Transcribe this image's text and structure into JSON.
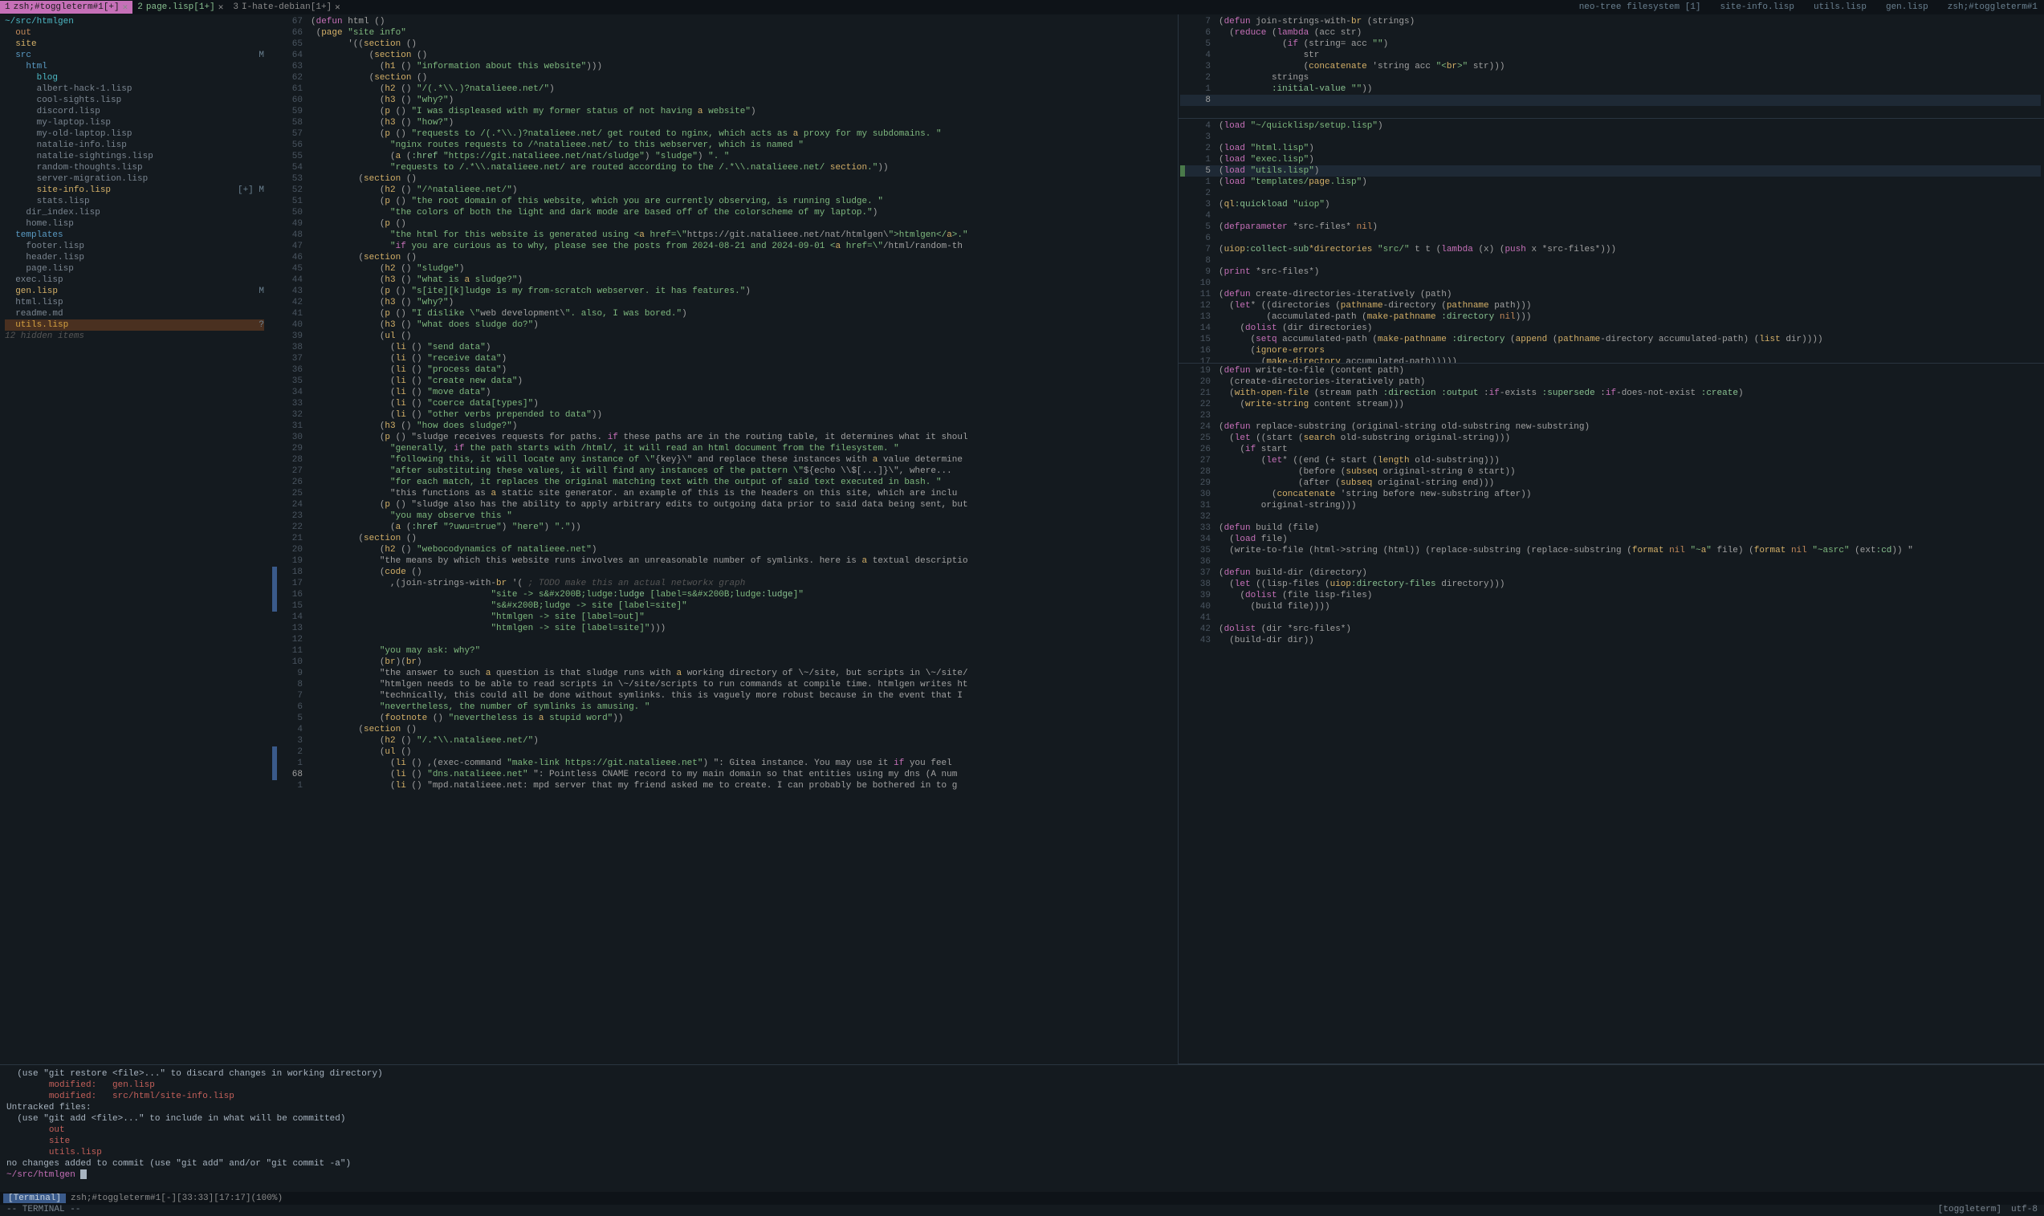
{
  "tabbar": {
    "tabs": [
      {
        "num": "1",
        "label": "zsh;#toggleterm#1[+]",
        "active": true,
        "closable": true
      },
      {
        "num": "2",
        "label": "page.lisp[1+]",
        "active": false,
        "green": true,
        "closable": true
      },
      {
        "num": "3",
        "label": "I-hate-debian[1+]",
        "active": false,
        "closable": true
      }
    ],
    "winbars": [
      "neo-tree filesystem [1]",
      "site-info.lisp",
      "utils.lisp",
      "gen.lisp",
      "zsh;#toggleterm#1"
    ]
  },
  "tree": {
    "root": "~/src/htmlgen",
    "items": [
      {
        "indent": 1,
        "name": "out",
        "cls": "t-orange"
      },
      {
        "indent": 1,
        "name": "site",
        "cls": "t-yellow"
      },
      {
        "indent": 1,
        "name": "src",
        "cls": "t-blue",
        "mark": "M"
      },
      {
        "indent": 2,
        "name": "html",
        "cls": "t-blue"
      },
      {
        "indent": 3,
        "name": "blog",
        "cls": "t-cyan"
      },
      {
        "indent": 3,
        "name": "albert-hack-1.lisp",
        "cls": "t-grey"
      },
      {
        "indent": 3,
        "name": "cool-sights.lisp",
        "cls": "t-grey"
      },
      {
        "indent": 3,
        "name": "discord.lisp",
        "cls": "t-grey"
      },
      {
        "indent": 3,
        "name": "my-laptop.lisp",
        "cls": "t-grey"
      },
      {
        "indent": 3,
        "name": "my-old-laptop.lisp",
        "cls": "t-grey"
      },
      {
        "indent": 3,
        "name": "natalie-info.lisp",
        "cls": "t-grey"
      },
      {
        "indent": 3,
        "name": "natalie-sightings.lisp",
        "cls": "t-grey"
      },
      {
        "indent": 3,
        "name": "random-thoughts.lisp",
        "cls": "t-grey"
      },
      {
        "indent": 3,
        "name": "server-migration.lisp",
        "cls": "t-grey"
      },
      {
        "indent": 3,
        "name": "site-info.lisp",
        "cls": "t-mod",
        "mark": "[+] M"
      },
      {
        "indent": 3,
        "name": "stats.lisp",
        "cls": "t-grey"
      },
      {
        "indent": 2,
        "name": "dir_index.lisp",
        "cls": "t-grey"
      },
      {
        "indent": 2,
        "name": "home.lisp",
        "cls": "t-grey"
      },
      {
        "indent": 1,
        "name": "templates",
        "cls": "t-blue"
      },
      {
        "indent": 2,
        "name": "footer.lisp",
        "cls": "t-grey"
      },
      {
        "indent": 2,
        "name": "header.lisp",
        "cls": "t-grey"
      },
      {
        "indent": 2,
        "name": "page.lisp",
        "cls": "t-grey"
      },
      {
        "indent": 1,
        "name": "exec.lisp",
        "cls": "t-grey"
      },
      {
        "indent": 1,
        "name": "gen.lisp",
        "cls": "t-mod",
        "mark": "M"
      },
      {
        "indent": 1,
        "name": "html.lisp",
        "cls": "t-grey"
      },
      {
        "indent": 1,
        "name": "readme.md",
        "cls": "t-grey"
      },
      {
        "indent": 1,
        "name": "utils.lisp",
        "cls": "blink-orange",
        "mark": "?"
      }
    ],
    "hidden": "12 hidden items"
  },
  "leftcode": {
    "cursor_line": 60,
    "lines": [
      {
        "n": 67,
        "t": "(defun html ()"
      },
      {
        "n": 66,
        "t": " (page \"site info\""
      },
      {
        "n": 65,
        "t": "       '((section ()"
      },
      {
        "n": 64,
        "t": "           (section ()"
      },
      {
        "n": 63,
        "t": "             (h1 () \"information about this website\")))"
      },
      {
        "n": 62,
        "t": "           (section ()"
      },
      {
        "n": 61,
        "t": "             (h2 () \"/(.*\\\\.)?natalieee.net/\")"
      },
      {
        "n": 60,
        "t": "             (h3 () \"why?\")"
      },
      {
        "n": 59,
        "t": "             (p () \"I was displeased with my former status of not having a website\")"
      },
      {
        "n": 58,
        "t": "             (h3 () \"how?\")"
      },
      {
        "n": 57,
        "t": "             (p () \"requests to /(.*\\\\.)?natalieee.net/ get routed to nginx, which acts as a proxy for my subdomains. \""
      },
      {
        "n": 56,
        "t": "               \"nginx routes requests to /^natalieee.net/ to this webserver, which is named \""
      },
      {
        "n": 55,
        "t": "               (a (:href \"https://git.natalieee.net/nat/sludge\") \"sludge\") \". \""
      },
      {
        "n": 54,
        "t": "               \"requests to /.*\\\\.natalieee.net/ are routed according to the /.*\\\\.natalieee.net/ section.\"))"
      },
      {
        "n": 53,
        "t": "         (section ()"
      },
      {
        "n": 52,
        "t": "             (h2 () \"/^natalieee.net/\")"
      },
      {
        "n": 51,
        "t": "             (p () \"the root domain of this website, which you are currently observing, is running sludge. \""
      },
      {
        "n": 50,
        "t": "               \"the colors of both the light and dark mode are based off of the colorscheme of my laptop.\")"
      },
      {
        "n": 49,
        "t": "             (p ()"
      },
      {
        "n": 48,
        "t": "               \"the html for this website is generated using <a href=\\\"https://git.natalieee.net/nat/htmlgen\\\">htmlgen</a>.\""
      },
      {
        "n": 47,
        "t": "               \"if you are curious as to why, please see the posts from 2024-08-21 and 2024-09-01 <a href=\\\"/html/random-th"
      },
      {
        "n": 46,
        "t": "         (section ()"
      },
      {
        "n": 45,
        "t": "             (h2 () \"sludge\")"
      },
      {
        "n": 44,
        "t": "             (h3 () \"what is a sludge?\")"
      },
      {
        "n": 43,
        "t": "             (p () \"s[ite][k]ludge is my from-scratch webserver. it has features.\")"
      },
      {
        "n": 42,
        "t": "             (h3 () \"why?\")"
      },
      {
        "n": 41,
        "t": "             (p () \"I dislike \\\"web development\\\". also, I was bored.\")"
      },
      {
        "n": 40,
        "t": "             (h3 () \"what does sludge do?\")"
      },
      {
        "n": 39,
        "t": "             (ul ()"
      },
      {
        "n": 38,
        "t": "               (li () \"send data\")"
      },
      {
        "n": 37,
        "t": "               (li () \"receive data\")"
      },
      {
        "n": 36,
        "t": "               (li () \"process data\")"
      },
      {
        "n": 35,
        "t": "               (li () \"create new data\")"
      },
      {
        "n": 34,
        "t": "               (li () \"move data\")"
      },
      {
        "n": 33,
        "t": "               (li () \"coerce data[types]\")"
      },
      {
        "n": 32,
        "t": "               (li () \"other verbs prepended to data\"))"
      },
      {
        "n": 31,
        "t": "             (h3 () \"how does sludge?\")"
      },
      {
        "n": 30,
        "t": "             (p () \"sludge receives requests for paths. if these paths are in the routing table, it determines what it shoul"
      },
      {
        "n": 29,
        "t": "               \"generally, if the path starts with /html/, it will read an html document from the filesystem. \""
      },
      {
        "n": 28,
        "t": "               \"following this, it will locate any instance of \\\"{key}\\\" and replace these instances with a value determine"
      },
      {
        "n": 27,
        "t": "               \"after substituting these values, it will find any instances of the pattern \\\"${echo \\\\$[...]}\\\", where..."
      },
      {
        "n": 26,
        "t": "               \"for each match, it replaces the original matching text with the output of said text executed in bash. \""
      },
      {
        "n": 25,
        "t": "               \"this functions as a static site generator. an example of this is the headers on this site, which are inclu"
      },
      {
        "n": 24,
        "t": "             (p () \"sludge also has the ability to apply arbitrary edits to outgoing data prior to said data being sent, but"
      },
      {
        "n": 23,
        "t": "               \"you may observe this \""
      },
      {
        "n": 22,
        "t": "               (a (:href \"?uwu=true\") \"here\") \".\"))"
      },
      {
        "n": 21,
        "t": "         (section ()"
      },
      {
        "n": 20,
        "t": "             (h2 () \"webocodynamics of natalieee.net\")"
      },
      {
        "n": 19,
        "t": "             \"the means by which this website runs involves an unreasonable number of symlinks. here is a textual descriptio"
      },
      {
        "n": 18,
        "t": "             (code ()",
        "sign": "change"
      },
      {
        "n": 17,
        "t": "               ,(join-strings-with-br '( ; TODO make this an actual networkx graph",
        "sign": "change"
      },
      {
        "n": 16,
        "t": "                                  \"site -> s&#x200B;ludge:ludge [label=s&#x200B;ludge:ludge]\"",
        "sign": "change"
      },
      {
        "n": 15,
        "t": "                                  \"s&#x200B;ludge -> site [label=site]\"",
        "sign": "change"
      },
      {
        "n": 14,
        "t": "                                  \"htmlgen -> site [label=out]\""
      },
      {
        "n": 13,
        "t": "                                  \"htmlgen -> site [label=site]\")))"
      },
      {
        "n": 12,
        "t": ""
      },
      {
        "n": 11,
        "t": "             \"you may ask: why?\""
      },
      {
        "n": 10,
        "t": "             (br)(br)"
      },
      {
        "n": 9,
        "t": "             \"the answer to such a question is that sludge runs with a working directory of \\~/site, but scripts in \\~/site/"
      },
      {
        "n": 8,
        "t": "             \"htmlgen needs to be able to read scripts in \\~/site/scripts to run commands at compile time. htmlgen writes ht"
      },
      {
        "n": 7,
        "t": "             \"technically, this could all be done without symlinks. this is vaguely more robust because in the event that I "
      },
      {
        "n": 6,
        "t": "             \"nevertheless, the number of symlinks is amusing. \""
      },
      {
        "n": 5,
        "t": "             (footnote () \"nevertheless is a stupid word\"))"
      },
      {
        "n": 4,
        "t": "         (section ()"
      },
      {
        "n": 3,
        "t": "             (h2 () \"/.*\\\\.natalieee.net/\")"
      },
      {
        "n": 2,
        "t": "             (ul ()",
        "sign": "change"
      },
      {
        "n": 1,
        "t": "               (li () ,(exec-command \"make-link https://git.natalieee.net\") \": Gitea instance. You may use it if you feel",
        "sign": "change"
      },
      {
        "n": "68",
        "t": "               (li () \"dns.natalieee.net\" \": Pointless CNAME record to my main domain so that entities using my dns (A num",
        "cur": true,
        "sign": "change"
      },
      {
        "n": 1,
        "t": "               (li () \"mpd.natalieee.net: mpd server that my friend asked me to create. I can probably be bothered in to g"
      }
    ]
  },
  "right_pane1": [
    {
      "n": 7,
      "t": "(defun join-strings-with-br (strings)"
    },
    {
      "n": 6,
      "t": "  (reduce (lambda (acc str)"
    },
    {
      "n": 5,
      "t": "            (if (string= acc \"\")"
    },
    {
      "n": 4,
      "t": "                str"
    },
    {
      "n": 3,
      "t": "                (concatenate 'string acc \"<br>\" str)))"
    },
    {
      "n": 2,
      "t": "          strings"
    },
    {
      "n": 1,
      "t": "          :initial-value \"\"))"
    },
    {
      "n": "8",
      "t": "",
      "cur": true,
      "hl": true
    }
  ],
  "right_pane2": [
    {
      "n": 4,
      "t": "(load \"~/quicklisp/setup.lisp\")"
    },
    {
      "n": 3,
      "t": ""
    },
    {
      "n": 2,
      "t": "(load \"html.lisp\")"
    },
    {
      "n": 1,
      "t": "(load \"exec.lisp\")"
    },
    {
      "n": "5",
      "t": "(load \"utils.lisp\")",
      "cur": true,
      "hl": true,
      "sign": "add"
    },
    {
      "n": 1,
      "t": "(load \"templates/page.lisp\")"
    },
    {
      "n": 2,
      "t": ""
    },
    {
      "n": 3,
      "t": "(ql:quickload \"uiop\")"
    },
    {
      "n": 4,
      "t": ""
    },
    {
      "n": 5,
      "t": "(defparameter *src-files* nil)"
    },
    {
      "n": 6,
      "t": ""
    },
    {
      "n": 7,
      "t": "(uiop:collect-sub*directories \"src/\" t t (lambda (x) (push x *src-files*)))"
    },
    {
      "n": 8,
      "t": ""
    },
    {
      "n": 9,
      "t": "(print *src-files*)"
    },
    {
      "n": 10,
      "t": ""
    },
    {
      "n": 11,
      "t": "(defun create-directories-iteratively (path)"
    },
    {
      "n": 12,
      "t": "  (let* ((directories (pathname-directory (pathname path)))"
    },
    {
      "n": 13,
      "t": "         (accumulated-path (make-pathname :directory nil)))"
    },
    {
      "n": 14,
      "t": "    (dolist (dir directories)"
    },
    {
      "n": 15,
      "t": "      (setq accumulated-path (make-pathname :directory (append (pathname-directory accumulated-path) (list dir))))"
    },
    {
      "n": 16,
      "t": "      (ignore-errors"
    },
    {
      "n": 17,
      "t": "        (make-directory accumulated-path)))))"
    },
    {
      "n": 18,
      "t": ""
    }
  ],
  "right_pane3": [
    {
      "n": 19,
      "t": "(defun write-to-file (content path)"
    },
    {
      "n": 20,
      "t": "  (create-directories-iteratively path)"
    },
    {
      "n": 21,
      "t": "  (with-open-file (stream path :direction :output :if-exists :supersede :if-does-not-exist :create)"
    },
    {
      "n": 22,
      "t": "    (write-string content stream)))"
    },
    {
      "n": 23,
      "t": ""
    },
    {
      "n": 24,
      "t": "(defun replace-substring (original-string old-substring new-substring)"
    },
    {
      "n": 25,
      "t": "  (let ((start (search old-substring original-string)))"
    },
    {
      "n": 26,
      "t": "    (if start"
    },
    {
      "n": 27,
      "t": "        (let* ((end (+ start (length old-substring)))"
    },
    {
      "n": 28,
      "t": "               (before (subseq original-string 0 start))"
    },
    {
      "n": 29,
      "t": "               (after (subseq original-string end)))"
    },
    {
      "n": 30,
      "t": "          (concatenate 'string before new-substring after))"
    },
    {
      "n": 31,
      "t": "        original-string)))"
    },
    {
      "n": 32,
      "t": ""
    },
    {
      "n": 33,
      "t": "(defun build (file)"
    },
    {
      "n": 34,
      "t": "  (load file)"
    },
    {
      "n": 35,
      "t": "  (write-to-file (html->string (html)) (replace-substring (replace-substring (format nil \"~a\" file) (format nil \"~asrc\" (ext:cd)) \""
    },
    {
      "n": 36,
      "t": ""
    },
    {
      "n": 37,
      "t": "(defun build-dir (directory)"
    },
    {
      "n": 38,
      "t": "  (let ((lisp-files (uiop:directory-files directory)))"
    },
    {
      "n": 39,
      "t": "    (dolist (file lisp-files)"
    },
    {
      "n": 40,
      "t": "      (build file))))"
    },
    {
      "n": 41,
      "t": ""
    },
    {
      "n": 42,
      "t": "(dolist (dir *src-files*)"
    },
    {
      "n": 43,
      "t": "  (build-dir dir))"
    }
  ],
  "terminal": {
    "lines": [
      "  (use \"git restore <file>...\" to discard changes in working directory)",
      "        modified:   gen.lisp",
      "        modified:   src/html/site-info.lisp",
      "",
      "Untracked files:",
      "  (use \"git add <file>...\" to include in what will be committed)",
      "        out",
      "        site",
      "        utils.lisp",
      "",
      "no changes added to commit (use \"git add\" and/or \"git commit -a\")"
    ],
    "prompt_path": "~/src/htmlgen",
    "status_label": "[Terminal]",
    "status_title": "zsh;#toggleterm#1[-][33:33][17:17](100%)"
  },
  "statusbar": {
    "mode": "-- TERMINAL --",
    "right": [
      "[toggleterm]",
      "utf-8"
    ]
  }
}
